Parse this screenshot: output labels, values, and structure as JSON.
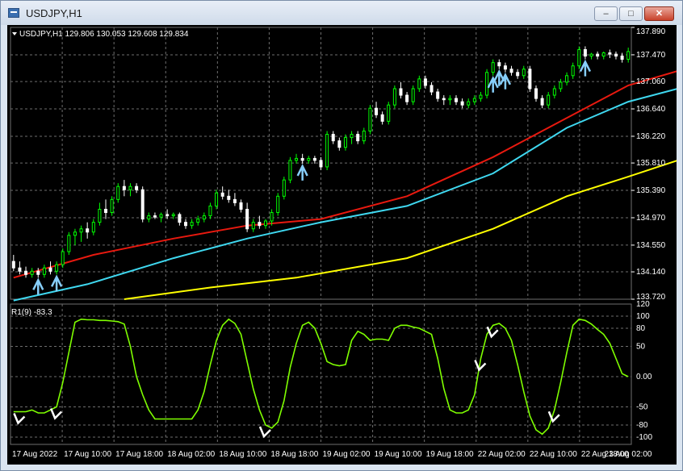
{
  "window": {
    "title": "USDJPY,H1",
    "minimize_glyph": "–",
    "maximize_glyph": "□",
    "close_glyph": "✕"
  },
  "chart": {
    "info_label": "USDJPY,H1  129.806 130.053 129.608 129.834",
    "symbol_menu_icon": "triangle-down-icon"
  },
  "indicator": {
    "label": "R1(9) -83.3"
  },
  "colors": {
    "background": "#000000",
    "grid": "#6e6e6e",
    "text": "#ffffff",
    "bull_candle": "#00ff00",
    "bear_candle": "#ffffff",
    "ma_fast": "#e8190f",
    "ma_mid": "#3fd8f0",
    "ma_slow": "#ffff00",
    "oscillator": "#7fff00",
    "buy_arrow": "#87cefa",
    "signal_mark": "#ffffff"
  },
  "chart_data": {
    "type": "line",
    "price_axis_ticks": [
      "137.890",
      "137.470",
      "137.060",
      "136.640",
      "136.220",
      "135.810",
      "135.390",
      "134.970",
      "134.550",
      "134.140",
      "133.720"
    ],
    "price_ylim": [
      133.72,
      137.89
    ],
    "oscillator_axis_ticks": [
      "120",
      "100",
      "80",
      "50",
      "0.00",
      "-50",
      "-80",
      "-100"
    ],
    "oscillator_ylim": [
      -112,
      120
    ],
    "time_labels": [
      "17 Aug 2022",
      "17 Aug 10:00",
      "17 Aug 18:00",
      "18 Aug 02:00",
      "18 Aug 10:00",
      "18 Aug 18:00",
      "19 Aug 02:00",
      "19 Aug 10:00",
      "19 Aug 18:00",
      "22 Aug 02:00",
      "22 Aug 10:00",
      "22 Aug 18:00",
      "23 Aug 02:00"
    ],
    "candles": [
      [
        134.3,
        134.4,
        134.15,
        134.2
      ],
      [
        134.2,
        134.3,
        134.1,
        134.15
      ],
      [
        134.15,
        134.22,
        134.05,
        134.1
      ],
      [
        134.1,
        134.2,
        134.05,
        134.15
      ],
      [
        134.15,
        134.2,
        134.05,
        134.1
      ],
      [
        134.1,
        134.25,
        134.05,
        134.2
      ],
      [
        134.2,
        134.3,
        134.1,
        134.15
      ],
      [
        134.15,
        134.3,
        134.1,
        134.25
      ],
      [
        134.25,
        134.5,
        134.2,
        134.45
      ],
      [
        134.45,
        134.75,
        134.4,
        134.7
      ],
      [
        134.7,
        134.8,
        134.55,
        134.75
      ],
      [
        134.75,
        134.85,
        134.6,
        134.8
      ],
      [
        134.8,
        134.9,
        134.65,
        134.75
      ],
      [
        134.75,
        134.95,
        134.7,
        134.9
      ],
      [
        134.9,
        135.2,
        134.85,
        135.1
      ],
      [
        135.1,
        135.25,
        134.95,
        135.05
      ],
      [
        135.05,
        135.3,
        135.0,
        135.25
      ],
      [
        135.25,
        135.5,
        135.2,
        135.45
      ],
      [
        135.45,
        135.55,
        135.3,
        135.4
      ],
      [
        135.4,
        135.5,
        135.3,
        135.45
      ],
      [
        135.45,
        135.5,
        135.35,
        135.4
      ],
      [
        135.4,
        135.45,
        134.9,
        134.95
      ],
      [
        134.95,
        135.05,
        134.9,
        135.0
      ],
      [
        135.0,
        135.05,
        134.95,
        134.98
      ],
      [
        134.98,
        135.05,
        134.9,
        135.02
      ],
      [
        135.02,
        135.1,
        134.95,
        135.0
      ],
      [
        135.0,
        135.05,
        134.95,
        135.02
      ],
      [
        135.02,
        135.05,
        134.85,
        134.9
      ],
      [
        134.9,
        134.95,
        134.8,
        134.85
      ],
      [
        134.85,
        134.95,
        134.8,
        134.9
      ],
      [
        134.9,
        135.0,
        134.85,
        134.95
      ],
      [
        134.95,
        135.05,
        134.9,
        135.0
      ],
      [
        135.0,
        135.2,
        134.95,
        135.15
      ],
      [
        135.15,
        135.4,
        135.1,
        135.35
      ],
      [
        135.35,
        135.45,
        135.25,
        135.3
      ],
      [
        135.3,
        135.4,
        135.2,
        135.25
      ],
      [
        135.25,
        135.35,
        135.15,
        135.2
      ],
      [
        135.2,
        135.25,
        135.05,
        135.1
      ],
      [
        135.1,
        135.2,
        134.75,
        134.8
      ],
      [
        134.8,
        134.95,
        134.75,
        134.9
      ],
      [
        134.9,
        135.0,
        134.8,
        134.85
      ],
      [
        134.85,
        134.95,
        134.8,
        134.92
      ],
      [
        134.92,
        135.1,
        134.85,
        135.05
      ],
      [
        135.05,
        135.35,
        135.0,
        135.3
      ],
      [
        135.3,
        135.6,
        135.25,
        135.55
      ],
      [
        135.55,
        135.9,
        135.5,
        135.85
      ],
      [
        135.85,
        135.95,
        135.8,
        135.88
      ],
      [
        135.88,
        135.95,
        135.8,
        135.85
      ],
      [
        135.85,
        135.92,
        135.8,
        135.88
      ],
      [
        135.88,
        135.92,
        135.8,
        135.85
      ],
      [
        135.85,
        135.9,
        135.7,
        135.75
      ],
      [
        135.75,
        136.3,
        135.7,
        136.25
      ],
      [
        136.25,
        136.3,
        136.1,
        136.15
      ],
      [
        136.15,
        136.2,
        136.0,
        136.05
      ],
      [
        136.05,
        136.25,
        136.0,
        136.2
      ],
      [
        136.2,
        136.3,
        136.1,
        136.25
      ],
      [
        136.25,
        136.3,
        136.1,
        136.15
      ],
      [
        136.15,
        136.35,
        136.1,
        136.3
      ],
      [
        136.3,
        136.7,
        136.25,
        136.65
      ],
      [
        136.65,
        136.75,
        136.5,
        136.55
      ],
      [
        136.55,
        136.6,
        136.4,
        136.45
      ],
      [
        136.45,
        136.75,
        136.4,
        136.7
      ],
      [
        136.7,
        137.0,
        136.65,
        136.95
      ],
      [
        136.95,
        137.05,
        136.8,
        136.85
      ],
      [
        136.85,
        136.9,
        136.7,
        136.75
      ],
      [
        136.75,
        137.0,
        136.7,
        136.95
      ],
      [
        136.95,
        137.15,
        136.9,
        137.1
      ],
      [
        137.1,
        137.15,
        136.95,
        137.0
      ],
      [
        137.0,
        137.05,
        136.85,
        136.9
      ],
      [
        136.9,
        136.95,
        136.75,
        136.8
      ],
      [
        136.8,
        136.85,
        136.7,
        136.78
      ],
      [
        136.78,
        136.85,
        136.7,
        136.8
      ],
      [
        136.8,
        136.85,
        136.7,
        136.75
      ],
      [
        136.75,
        136.8,
        136.65,
        136.7
      ],
      [
        136.7,
        136.8,
        136.65,
        136.75
      ],
      [
        136.75,
        136.85,
        136.7,
        136.8
      ],
      [
        136.8,
        136.9,
        136.75,
        136.85
      ],
      [
        136.85,
        137.25,
        136.8,
        137.2
      ],
      [
        137.2,
        137.4,
        137.15,
        137.35
      ],
      [
        137.35,
        137.4,
        137.25,
        137.3
      ],
      [
        137.3,
        137.35,
        137.2,
        137.25
      ],
      [
        137.25,
        137.3,
        137.15,
        137.2
      ],
      [
        137.2,
        137.25,
        137.1,
        137.15
      ],
      [
        137.15,
        137.3,
        137.1,
        137.25
      ],
      [
        137.25,
        137.3,
        136.9,
        136.95
      ],
      [
        136.95,
        137.0,
        136.75,
        136.8
      ],
      [
        136.8,
        136.85,
        136.65,
        136.7
      ],
      [
        136.7,
        136.9,
        136.65,
        136.85
      ],
      [
        136.85,
        137.0,
        136.8,
        136.95
      ],
      [
        136.95,
        137.1,
        136.9,
        137.05
      ],
      [
        137.05,
        137.2,
        137.0,
        137.15
      ],
      [
        137.15,
        137.35,
        137.1,
        137.3
      ],
      [
        137.3,
        137.6,
        137.25,
        137.55
      ],
      [
        137.55,
        137.6,
        137.4,
        137.45
      ],
      [
        137.45,
        137.5,
        137.4,
        137.48
      ],
      [
        137.48,
        137.52,
        137.4,
        137.45
      ],
      [
        137.45,
        137.52,
        137.4,
        137.5
      ],
      [
        137.5,
        137.55,
        137.42,
        137.48
      ],
      [
        137.48,
        137.52,
        137.4,
        137.45
      ],
      [
        137.45,
        137.5,
        137.35,
        137.4
      ],
      [
        137.4,
        137.58,
        137.35,
        137.52
      ]
    ],
    "series": [
      {
        "points": [
          [
            0,
            134.05
          ],
          [
            13,
            134.4
          ],
          [
            26,
            134.65
          ],
          [
            38,
            134.85
          ],
          [
            50,
            134.95
          ],
          [
            64,
            135.3
          ],
          [
            78,
            135.9
          ],
          [
            90,
            136.5
          ],
          [
            100,
            137.0
          ],
          [
            108,
            137.22
          ]
        ]
      },
      {
        "points": [
          [
            0,
            133.7
          ],
          [
            12,
            133.95
          ],
          [
            26,
            134.35
          ],
          [
            38,
            134.65
          ],
          [
            50,
            134.9
          ],
          [
            64,
            135.15
          ],
          [
            78,
            135.65
          ],
          [
            90,
            136.35
          ],
          [
            100,
            136.75
          ],
          [
            108,
            136.95
          ]
        ]
      },
      {
        "points": [
          [
            18,
            133.72
          ],
          [
            32,
            133.9
          ],
          [
            46,
            134.05
          ],
          [
            64,
            134.35
          ],
          [
            78,
            134.8
          ],
          [
            90,
            135.3
          ],
          [
            100,
            135.6
          ],
          [
            108,
            135.85
          ]
        ]
      }
    ],
    "oscillator": [
      -58,
      -58,
      -58,
      -55,
      -60,
      -60,
      -55,
      -50,
      -10,
      40,
      90,
      95,
      94,
      94,
      93,
      93,
      92,
      91,
      87,
      50,
      0,
      -30,
      -55,
      -70,
      -70,
      -70,
      -70,
      -70,
      -70,
      -70,
      -55,
      -25,
      20,
      60,
      85,
      95,
      88,
      70,
      25,
      -20,
      -55,
      -80,
      -85,
      -75,
      -40,
      15,
      55,
      85,
      90,
      80,
      55,
      25,
      20,
      18,
      20,
      60,
      75,
      70,
      60,
      62,
      62,
      60,
      80,
      85,
      85,
      82,
      80,
      75,
      70,
      30,
      -20,
      -55,
      -60,
      -60,
      -55,
      -30,
      30,
      70,
      85,
      88,
      80,
      60,
      20,
      -25,
      -65,
      -88,
      -95,
      -85,
      -55,
      -10,
      40,
      85,
      95,
      93,
      87,
      78,
      70,
      55,
      30,
      5,
      0
    ],
    "buy_signal_indices": [
      4,
      7,
      47,
      78,
      79,
      80,
      93
    ],
    "oscillator_signal_indices": [
      1,
      7,
      41,
      76,
      78,
      88
    ]
  }
}
